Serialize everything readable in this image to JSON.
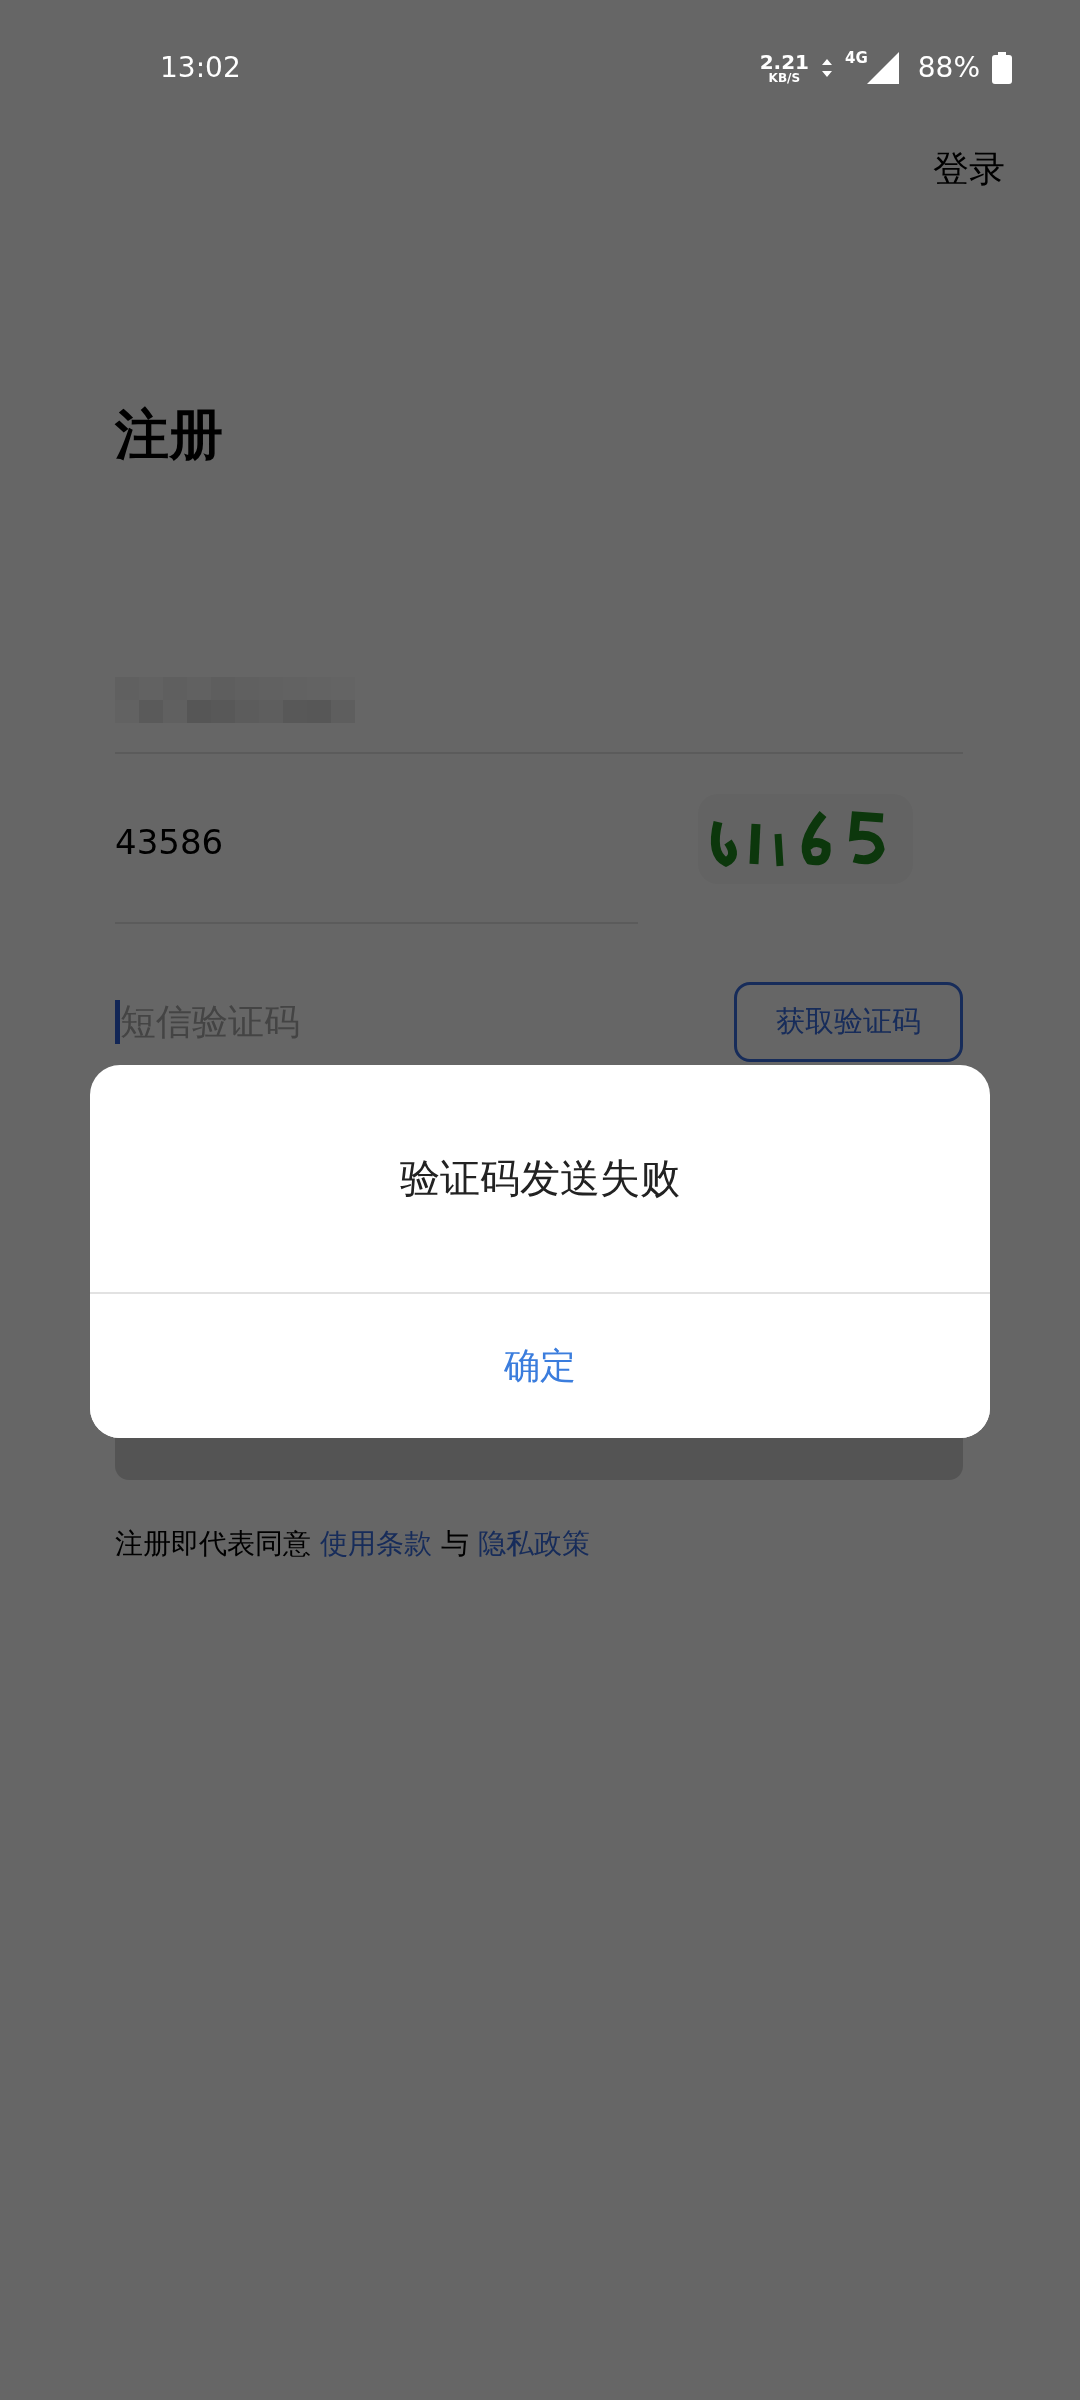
{
  "status_bar": {
    "time": "13:02",
    "net_speed": "2.21",
    "net_unit": "KB/S",
    "network": "4G",
    "battery": "88%"
  },
  "header": {
    "login_link": "登录"
  },
  "title": "注册",
  "captcha": {
    "value": "43586"
  },
  "sms": {
    "placeholder": "短信验证码",
    "focused": true,
    "button": "获取验证码"
  },
  "register_button": {
    "disabled": true
  },
  "terms": {
    "prefix": "注册即代表同意",
    "link1": "使用条款",
    "joiner": "与",
    "link2": "隐私政策"
  },
  "dialog": {
    "message": "验证码发送失败",
    "confirm": "确定"
  }
}
